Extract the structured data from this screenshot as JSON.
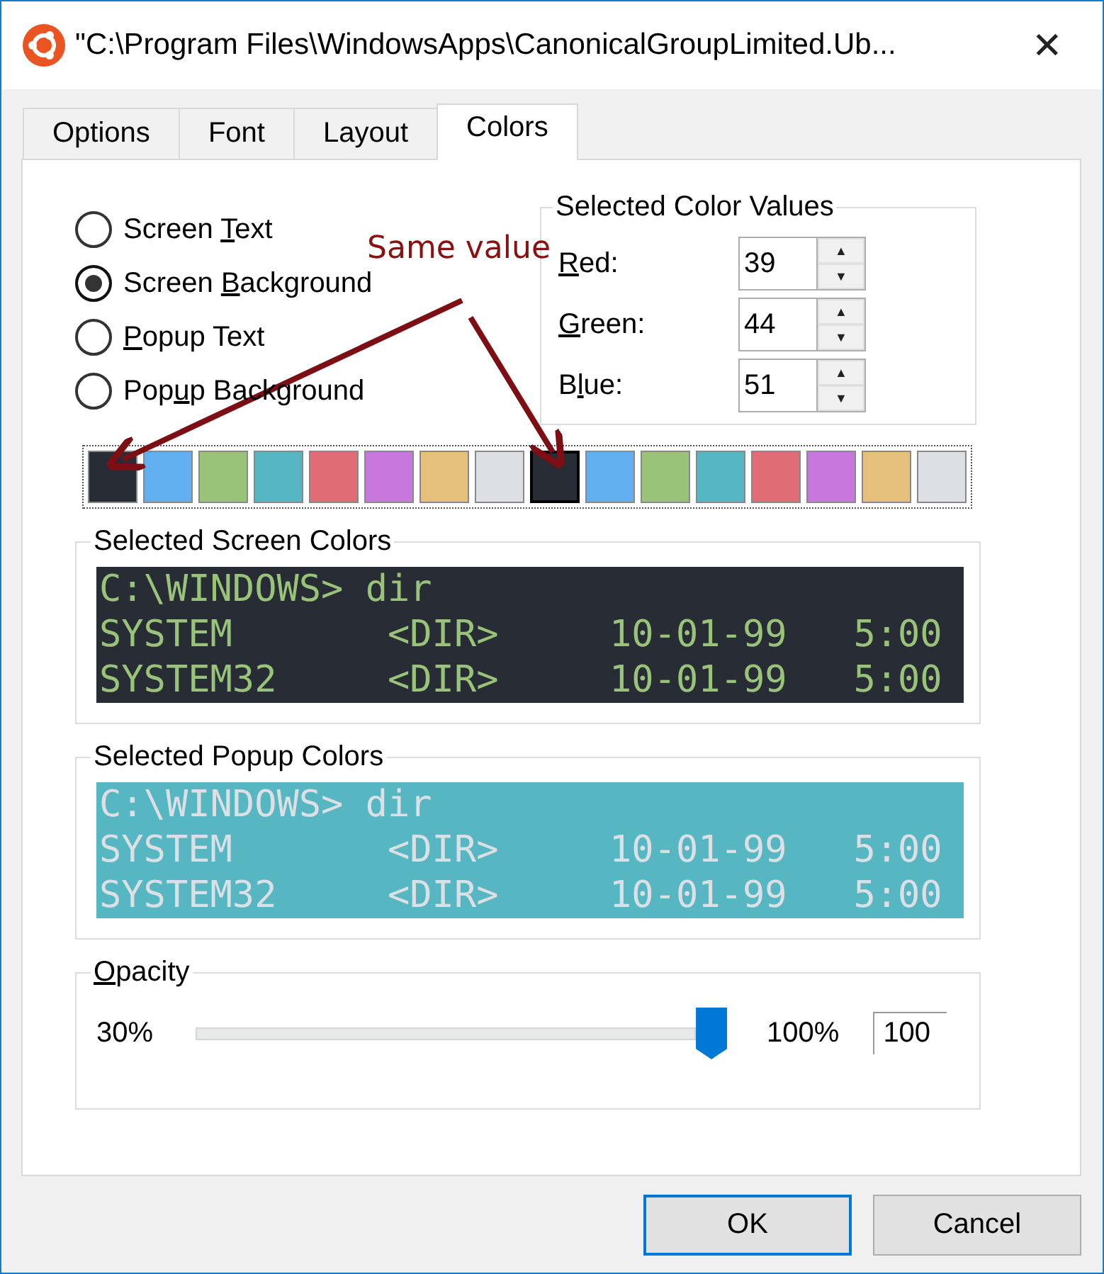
{
  "window": {
    "title": "\"C:\\Program Files\\WindowsApps\\CanonicalGroupLimited.Ub...",
    "close": "✕"
  },
  "tabs": [
    {
      "label": "Options",
      "selected": false
    },
    {
      "label": "Font",
      "selected": false
    },
    {
      "label": "Layout",
      "selected": false
    },
    {
      "label": "Colors",
      "selected": true
    }
  ],
  "color_targets": [
    {
      "before": "Screen ",
      "key": "T",
      "after": "ext",
      "selected": false
    },
    {
      "before": "Screen ",
      "key": "B",
      "after": "ackground",
      "selected": true
    },
    {
      "key": "P",
      "after": "opup Text",
      "selected": false
    },
    {
      "before": "Pop",
      "key": "u",
      "after": "p Background",
      "selected": false
    }
  ],
  "color_values": {
    "title": "Selected Color Values",
    "fields": [
      {
        "key": "R",
        "after": "ed:",
        "value": "39"
      },
      {
        "key": "G",
        "after": "reen:",
        "value": "44"
      },
      {
        "before": "B",
        "key": "l",
        "after": "ue:",
        "value": "51"
      }
    ],
    "up": "▲",
    "down": "▼"
  },
  "palette": [
    {
      "color": "#282c34",
      "selected": false
    },
    {
      "color": "#61afef",
      "selected": false
    },
    {
      "color": "#98c379",
      "selected": false
    },
    {
      "color": "#56b6c2",
      "selected": false
    },
    {
      "color": "#e06c75",
      "selected": false
    },
    {
      "color": "#c678dd",
      "selected": false
    },
    {
      "color": "#e5c07b",
      "selected": false
    },
    {
      "color": "#dcdfe4",
      "selected": false
    },
    {
      "color": "#282c34",
      "selected": true
    },
    {
      "color": "#61afef",
      "selected": false
    },
    {
      "color": "#98c379",
      "selected": false
    },
    {
      "color": "#56b6c2",
      "selected": false
    },
    {
      "color": "#e06c75",
      "selected": false
    },
    {
      "color": "#c678dd",
      "selected": false
    },
    {
      "color": "#e5c07b",
      "selected": false
    },
    {
      "color": "#dcdfe4",
      "selected": false
    }
  ],
  "screen_preview": {
    "kind": "screen",
    "title": "Selected Screen Colors",
    "lines": [
      "C:\\WINDOWS> dir",
      "SYSTEM       <DIR>     10-01-99   5:00",
      "SYSTEM32     <DIR>     10-01-99   5:00"
    ]
  },
  "popup_preview": {
    "kind": "popup",
    "title": "Selected Popup Colors",
    "lines": [
      "C:\\WINDOWS> dir",
      "SYSTEM       <DIR>     10-01-99   5:00",
      "SYSTEM32     <DIR>     10-01-99   5:00"
    ]
  },
  "opacity": {
    "key": "O",
    "after": "pacity",
    "min": "30%",
    "max": "100%",
    "level": 1,
    "value": "100"
  },
  "annotation": {
    "text": "Same value"
  },
  "buttons": [
    {
      "label": "OK",
      "default": true
    },
    {
      "label": "Cancel",
      "default": false
    }
  ]
}
